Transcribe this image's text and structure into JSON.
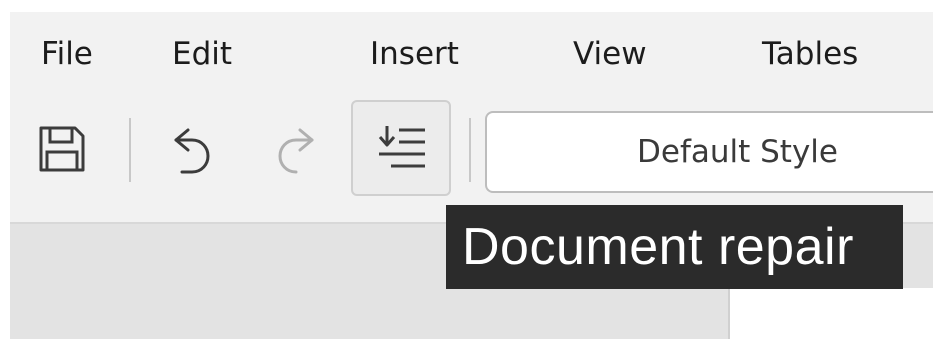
{
  "menubar": {
    "items": [
      {
        "label": "File"
      },
      {
        "label": "Edit"
      },
      {
        "label": "Insert"
      },
      {
        "label": "View"
      },
      {
        "label": "Tables"
      }
    ]
  },
  "toolbar": {
    "buttons": [
      {
        "icon": "save-icon",
        "enabled": true
      },
      {
        "icon": "undo-icon",
        "enabled": true
      },
      {
        "icon": "redo-icon",
        "enabled": false
      },
      {
        "icon": "document-repair-icon",
        "enabled": true,
        "active": true
      }
    ],
    "paragraph_style": {
      "value": "Default Style"
    }
  },
  "tooltip": {
    "text": "Document repair"
  },
  "colors": {
    "toolbar_bg": "#f2f2f2",
    "workspace_bg": "#e3e3e3",
    "tooltip_bg": "#2b2b2b",
    "icon_enabled": "#3c3c3c",
    "icon_disabled": "#b0b0b0"
  }
}
